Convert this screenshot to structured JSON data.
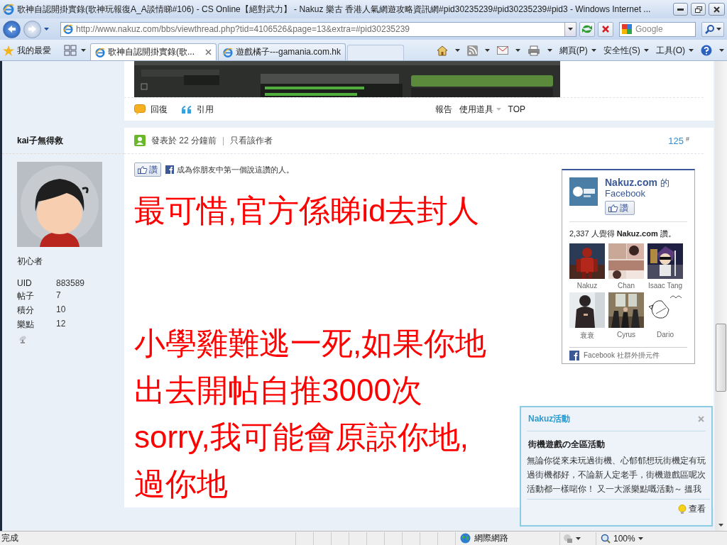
{
  "window": {
    "title": "歌神自認開掛實錄(歌神玩報復A_A談情睇#106) - CS Online【絕對武力】 - Nakuz 樂古 香港人氣網遊攻略資訊網#pid30235239#pid30235239#pid3 - Windows Internet ..."
  },
  "toolbar": {
    "url": "http://www.nakuz.com/bbs/viewthread.php?tid=4106526&page=13&extra=#pid30235239",
    "search_placeholder": "Google"
  },
  "favorites": "我的最愛",
  "tabs": [
    {
      "label": "歌神自認開掛實錄(歌...",
      "selected": true
    },
    {
      "label": "遊戲橘子---gamania.com.hk",
      "selected": false
    }
  ],
  "menus": [
    "網頁(P)",
    "安全性(S)",
    "工具(O)"
  ],
  "prev_post": {
    "actions": [
      {
        "kind": "reply",
        "label": "回復"
      },
      {
        "kind": "quote",
        "label": "引用"
      }
    ],
    "tools": [
      {
        "label": "報告",
        "dropdown": false
      },
      {
        "label": "使用道具",
        "dropdown": true
      },
      {
        "label": "TOP",
        "dropdown": false
      }
    ]
  },
  "post": {
    "author": "kai子無得救",
    "rank": "初心者",
    "stats": [
      {
        "label": "UID",
        "value": "883589"
      },
      {
        "label": "帖子",
        "value": "7"
      },
      {
        "label": "積分",
        "value": "10"
      },
      {
        "label": "樂點",
        "value": "12"
      }
    ],
    "posted_label": "發表於",
    "posted_time": "22 分鐘前",
    "separator": "|",
    "author_only": "只看該作者",
    "floor": "125",
    "floor_mark": "#",
    "like_button": "讚",
    "like_text": "成為你朋友中第一個說這讚的人。",
    "paragraphs": [
      {
        "lines": [
          "最可惜,官方係睇id去封人"
        ]
      },
      {
        "lines": [
          "小學雞難逃一死,如果你地",
          "出去開帖自推3000次",
          "sorry,我可能會原諒你地,",
          "過你地"
        ]
      }
    ]
  },
  "facebook_box": {
    "page_name": "Nakuz.com",
    "of": "的",
    "facebook": "Facebook",
    "like_button": "讚",
    "summary": "2,337 人覺得 **Nakuz.com** 讚。",
    "fans": [
      {
        "name": "Nakuz"
      },
      {
        "name": "Chan"
      },
      {
        "name": "Isaac Tang"
      },
      {
        "name": "衰衰"
      },
      {
        "name": "Cyrus"
      },
      {
        "name": "Dario"
      }
    ],
    "footer": "Facebook 社群外掛元件"
  },
  "popup": {
    "title": "Nakuz活動",
    "heading": "街機遊戲の全區活動",
    "body_lines": [
      "無論你從來未玩過街機、心郁郁想玩街機定有玩",
      "過街機都好，不論新人定老手，街機遊戲區呢次",
      "活動都一樣啱你！ 又一大派樂點嘅活動～ 搵我"
    ],
    "action": "查看"
  },
  "status_bar": {
    "text": "完成",
    "zone": "網際網路",
    "zoom": "100%"
  }
}
